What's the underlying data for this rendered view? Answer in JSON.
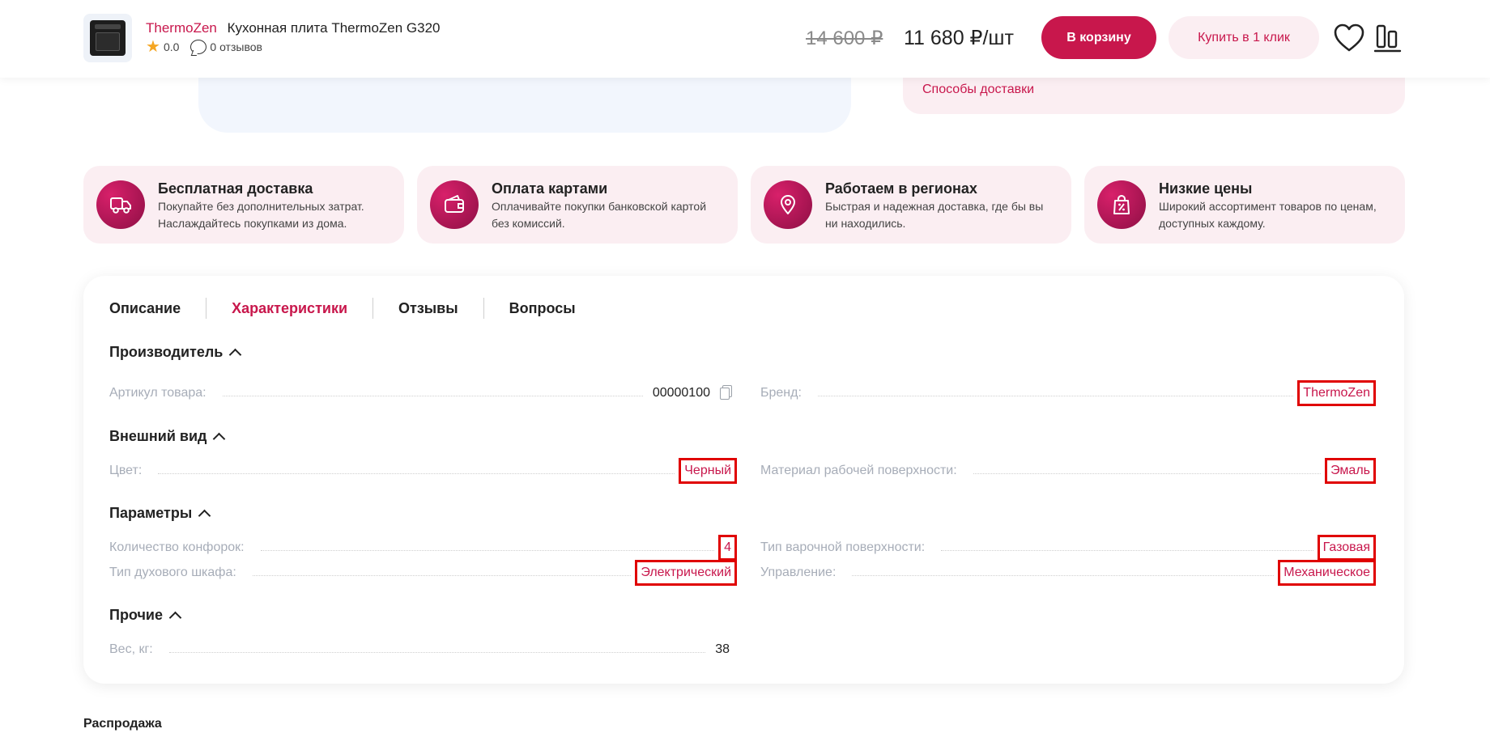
{
  "topbar": {
    "brand": "ThermoZen",
    "product_name": "Кухонная плита ThermoZen G320",
    "rating": "0.0",
    "reviews": "0 отзывов",
    "old_price": "14 600 ₽",
    "price": "11 680 ₽/шт",
    "cart_button": "В корзину",
    "one_click_button": "Купить в 1 клик"
  },
  "delivery": {
    "methods_link": "Способы доставки"
  },
  "advantages": [
    {
      "title": "Бесплатная доставка",
      "desc1": "Покупайте без дополнительных затрат.",
      "desc2": "Наслаждайтесь покупками из дома.",
      "icon": "truck-icon"
    },
    {
      "title": "Оплата картами",
      "desc1": "Оплачивайте покупки банковской картой",
      "desc2": "без комиссий.",
      "icon": "wallet-icon"
    },
    {
      "title": "Работаем в регионах",
      "desc1": "Быстрая и надежная доставка, где бы вы",
      "desc2": "ни находились.",
      "icon": "location-pin-icon"
    },
    {
      "title": "Низкие цены",
      "desc1": "Широкий ассортимент товаров по ценам,",
      "desc2": "доступных каждому.",
      "icon": "discount-bag-icon"
    }
  ],
  "tabs": [
    "Описание",
    "Характеристики",
    "Отзывы",
    "Вопросы"
  ],
  "active_tab": "Характеристики",
  "sections": {
    "manufacturer": {
      "title": "Производитель",
      "sku_label": "Артикул товара:",
      "sku_value": "00000100",
      "brand_label": "Бренд:",
      "brand_value": "ThermoZen"
    },
    "appearance": {
      "title": "Внешний вид",
      "color_label": "Цвет:",
      "color_value": "Черный",
      "surface_label": "Материал рабочей поверхности:",
      "surface_value": "Эмаль"
    },
    "params": {
      "title": "Параметры",
      "burners_label": "Количество конфорок:",
      "burners_value": "4",
      "hob_label": "Тип варочной поверхности:",
      "hob_value": "Газовая",
      "oven_label": "Тип духового шкафа:",
      "oven_value": "Электрический",
      "control_label": "Управление:",
      "control_value": "Механическое"
    },
    "other": {
      "title": "Прочие",
      "weight_label": "Вес, кг:",
      "weight_value": "38"
    }
  },
  "sale_title": "Распродажа",
  "colors": {
    "accent": "#c8174c",
    "accent_light": "#fbeef2",
    "highlight": "#e00000"
  }
}
